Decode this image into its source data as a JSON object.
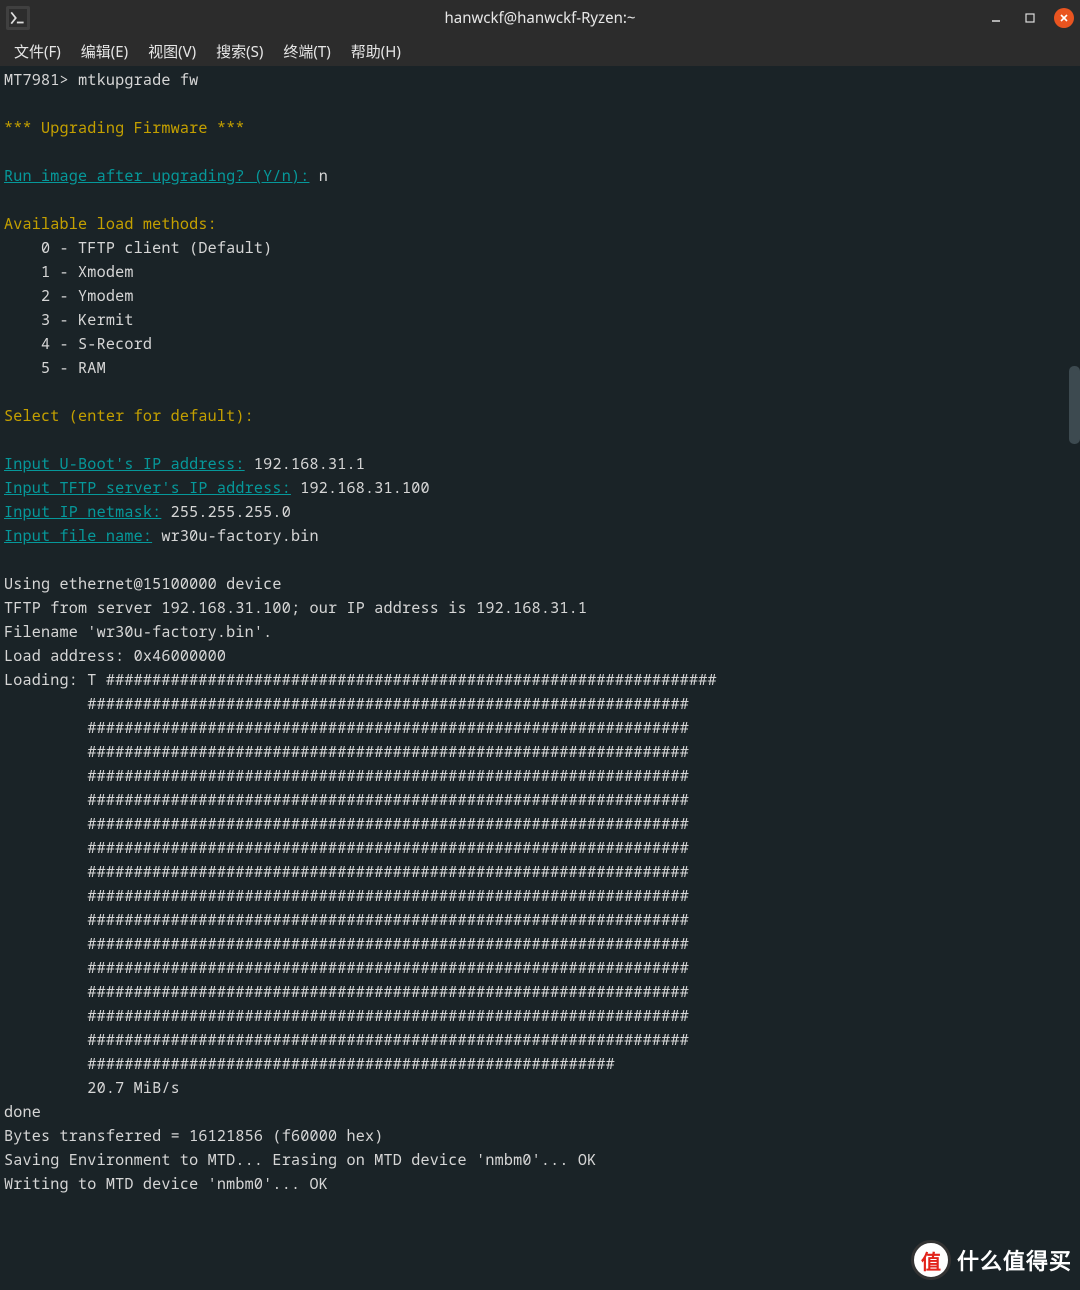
{
  "window": {
    "title": "hanwckf@hanwckf-Ryzen:~",
    "buttons": {
      "minimize": "–",
      "maximize": "⛶",
      "close": "✕"
    }
  },
  "menu": {
    "file": "文件(F)",
    "edit": "编辑(E)",
    "view": "视图(V)",
    "search": "搜索(S)",
    "terminal": "终端(T)",
    "help": "帮助(H)"
  },
  "term": {
    "prompt": "MT7981> ",
    "command": "mtkupgrade fw",
    "upgrading": "*** Upgrading Firmware ***",
    "run_q": "Run image after upgrading? (Y/n):",
    "run_a": " n",
    "avail": "Available load methods:",
    "m0": "    0 - TFTP client (Default)",
    "m1": "    1 - Xmodem",
    "m2": "    2 - Ymodem",
    "m3": "    3 - Kermit",
    "m4": "    4 - S-Record",
    "m5": "    5 - RAM",
    "select": "Select (enter for default):",
    "ip_ub_l": "Input U-Boot's IP address:",
    "ip_ub_v": " 192.168.31.1",
    "ip_srv_l": "Input TFTP server's IP address:",
    "ip_srv_v": " 192.168.31.100",
    "ip_nm_l": "Input IP netmask:",
    "ip_nm_v": " 255.255.255.0",
    "file_l": "Input file name:",
    "file_v": " wr30u-factory.bin",
    "using": "Using ethernet@15100000 device",
    "tftp": "TFTP from server 192.168.31.100; our IP address is 192.168.31.1",
    "filename": "Filename 'wr30u-factory.bin'.",
    "loadaddr": "Load address: 0x46000000",
    "loading_pref": "Loading: T ",
    "hash_first": "##################################################################",
    "hash_pad": "         ",
    "hash_full": "#################################################################",
    "hash_last": "#########################################################",
    "speed": "         20.7 MiB/s",
    "done": "done",
    "bytes": "Bytes transferred = 16121856 (f60000 hex)",
    "saving": "Saving Environment to MTD... Erasing on MTD device 'nmbm0'... OK",
    "writing": "Writing to MTD device 'nmbm0'... OK"
  },
  "watermark": {
    "circle": "值",
    "text": "什么值得买"
  }
}
